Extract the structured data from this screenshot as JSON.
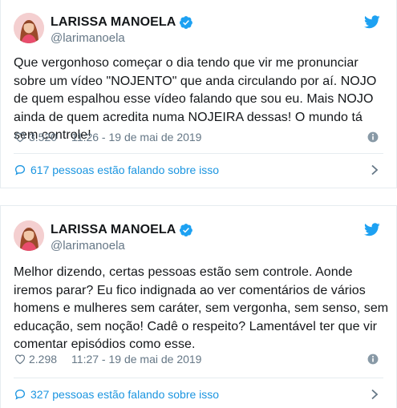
{
  "tweets": [
    {
      "author": {
        "display_name": "LARISSA MANOELA",
        "handle": "@larimanoela",
        "verified": true
      },
      "text": "Que vergonhoso começar o dia tendo que vir me pronunciar sobre um vídeo \"NOJENTO\" que anda circulando por aí. NOJO de quem espalhou esse vídeo falando que sou eu. Mais NOJO ainda de quem acredita numa NOJEIRA dessas! O mundo tá sem controle!",
      "likes": "3.520",
      "timestamp": "11:26 - 19 de mai de 2019",
      "conversation": "617 pessoas estão falando sobre isso"
    },
    {
      "author": {
        "display_name": "LARISSA MANOELA",
        "handle": "@larimanoela",
        "verified": true
      },
      "text": "Melhor dizendo, certas pessoas estão sem controle. Aonde iremos parar? Eu fico indignada ao ver comentários de vários homens e mulheres sem caráter, sem vergonha, sem senso, sem educação, sem noção! Cadê o respeito? Lamentável ter que vir comentar episódios como esse.",
      "likes": "2.298",
      "timestamp": "11:27 - 19 de mai de 2019",
      "conversation": "327 pessoas estão falando sobre isso"
    }
  ],
  "icons": {
    "verified": "verified-badge-icon",
    "brand": "twitter-bird-icon",
    "like": "heart-icon",
    "info": "info-icon",
    "reply": "reply-bubble-icon",
    "chevron": "chevron-right-icon"
  },
  "colors": {
    "text": "#14171a",
    "secondary": "#657786",
    "link": "#1b95e0",
    "verified": "#1da1f2",
    "border": "#e6ecf0"
  }
}
